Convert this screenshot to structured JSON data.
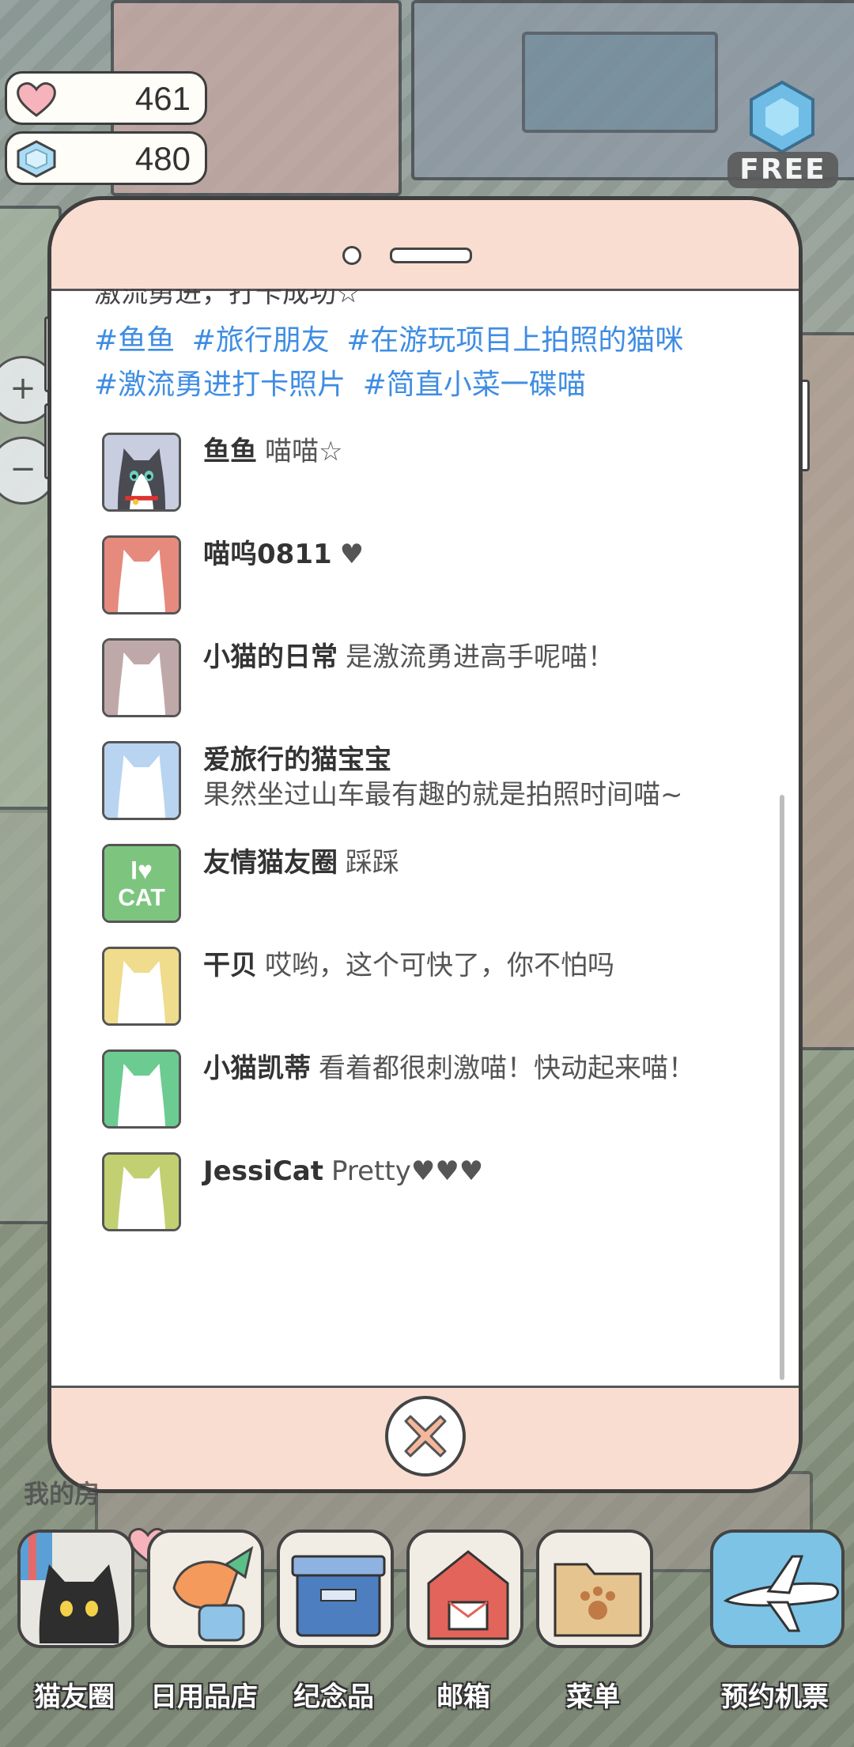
{
  "currency": {
    "hearts": "461",
    "gems": "480",
    "free_label": "FREE"
  },
  "post": {
    "text_tail": "激流勇进，打卡成功☆",
    "tags": [
      "#鱼鱼",
      "#旅行朋友",
      "#在游玩项目上拍照的猫咪",
      "#激流勇进打卡照片",
      "#简直小菜一碟喵"
    ]
  },
  "comments": [
    {
      "name": "鱼鱼",
      "message": "喵喵☆",
      "avatar_color": "#c9cde0",
      "avatar": "tuxedo-cat"
    },
    {
      "name": "喵呜0811",
      "message": "♥",
      "avatar_color": "#e58a7d",
      "avatar": "cat-silhouette"
    },
    {
      "name": "小猫的日常",
      "message": "是激流勇进高手呢喵！",
      "avatar_color": "#bfa9a8",
      "avatar": "cat-silhouette"
    },
    {
      "name": "爱旅行的猫宝宝",
      "message": "果然坐过山车最有趣的就是拍照时间喵~",
      "avatar_color": "#b9d4f0",
      "avatar": "cat-silhouette"
    },
    {
      "name": "友情猫友圈",
      "message": "踩踩",
      "avatar_color": "#7dc57e",
      "avatar": "i-love-cat"
    },
    {
      "name": "干贝",
      "message": "哎哟，这个可快了，你不怕吗",
      "avatar_color": "#efdc8c",
      "avatar": "cat-silhouette"
    },
    {
      "name": "小猫凯蒂",
      "message": "看着都很刺激喵！快动起来喵！",
      "avatar_color": "#6ccb91",
      "avatar": "cat-silhouette"
    },
    {
      "name": "JessiCat",
      "message": "Pretty♥♥♥",
      "avatar_color": "#c3d071",
      "avatar": "cat-silhouette"
    }
  ],
  "avatar_text": {
    "line1": "I♥",
    "line2": "CAT"
  },
  "dock": {
    "mine_label": "我的房",
    "items": [
      {
        "label": "猫友圈",
        "icon": "cat-friends-icon"
      },
      {
        "label": "日用品店",
        "icon": "shop-icon"
      },
      {
        "label": "纪念品",
        "icon": "souvenir-box-icon"
      },
      {
        "label": "邮箱",
        "icon": "mailbox-icon"
      },
      {
        "label": "菜单",
        "icon": "menu-folder-icon"
      },
      {
        "label": "预约机票",
        "icon": "airplane-ticket-icon"
      }
    ]
  },
  "colors": {
    "tag": "#3f8de2",
    "phone_accent": "#f9ddd1"
  }
}
